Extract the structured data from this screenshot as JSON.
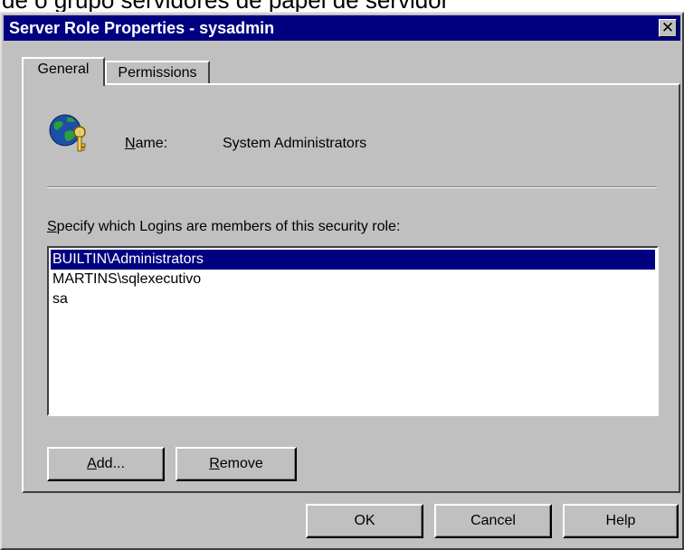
{
  "top_fragment": "de o grupo servidores de papel de servidor",
  "window": {
    "title": "Server Role Properties - sysadmin",
    "close_label": "✕"
  },
  "tabs": [
    {
      "label": "General",
      "active": true
    },
    {
      "label": "Permissions",
      "active": false
    }
  ],
  "general": {
    "icon": "role-key-globe-icon",
    "name_label_mnemonic": "N",
    "name_label_rest": "ame:",
    "name_value": "System Administrators",
    "specify_mnemonic": "S",
    "specify_rest": "pecify which Logins are members of this security role:",
    "logins": [
      "BUILTIN\\Administrators",
      "MARTINS\\sqlexecutivo",
      "sa"
    ],
    "selected_login": "BUILTIN\\Administrators",
    "add_mnemonic": "A",
    "add_rest": "dd...",
    "remove_mnemonic": "R",
    "remove_rest": "emove"
  },
  "footer": {
    "ok": "OK",
    "cancel": "Cancel",
    "help": "Help"
  },
  "colors": {
    "dialog_bg": "#c0c0c0",
    "title_bg": "#000080",
    "selection_bg": "#000080"
  }
}
